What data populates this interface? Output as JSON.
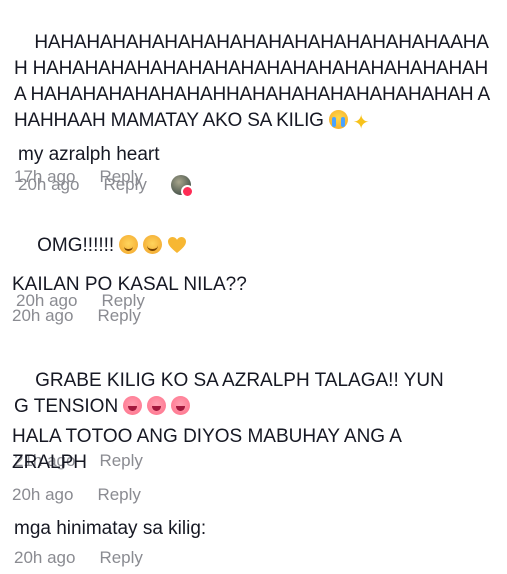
{
  "comments": [
    {
      "text": "HAHAHAHAHAHAHAHAHAHAHAHAHAHAHAHAAHAH HAHAHAHAHAHAHAHAHAHAHAHAHAHAHAHAHAHA HAHAHAHAHAHAHAHHAHAHAHAHAHAHAHAHAH AHAHHAAH MAMATAY AKO SA KILIG",
      "emojis": [
        "crying-face-icon",
        "sparkles-icon"
      ],
      "time": "17h ago",
      "reply": "Reply"
    },
    {
      "text": "my azralph heart",
      "emojis": [],
      "time": "20h ago",
      "reply": "Reply",
      "liked_by_creator": true
    },
    {
      "text": "OMG!!!!!!",
      "emojis": [
        "pleading-face-icon",
        "smiling-face-icon",
        "yellow-heart-icon"
      ],
      "time": "20h ago",
      "reply": "Reply"
    },
    {
      "text": "KAILAN PO KASAL NILA??",
      "emojis": [],
      "time": "20h ago",
      "reply": "Reply"
    },
    {
      "text": "GRABE KILIG KO SA AZRALPH TALAGA!! YUNG TENSION",
      "emojis": [
        "flushed-face-icon",
        "flushed-face-icon",
        "flushed-face-icon"
      ],
      "time": "21h ago",
      "reply": "Reply"
    },
    {
      "text": "HALA TOTOO ANG DIYOS MABUHAY ANG AZRALPH",
      "emojis": [],
      "time": "20h ago",
      "reply": "Reply"
    },
    {
      "text": "mga hinimatay sa kilig:",
      "emojis": [],
      "time": "20h ago",
      "reply": "Reply"
    }
  ],
  "colors": {
    "text": "#161823",
    "meta": "#8a8b91",
    "badge": "#fe2c55"
  }
}
